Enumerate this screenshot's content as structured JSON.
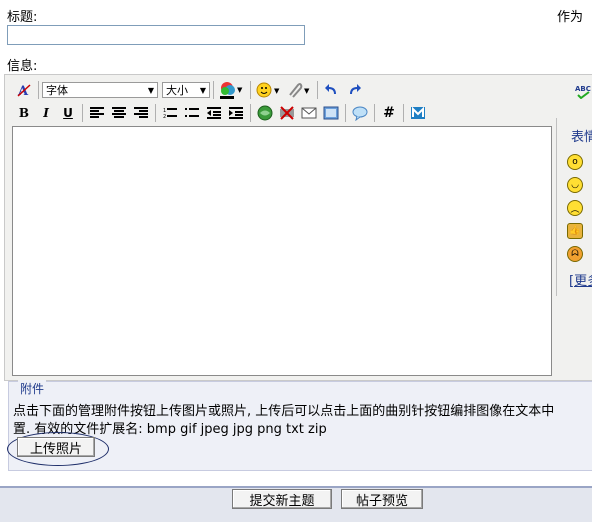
{
  "form": {
    "title_label": "标题:",
    "as_label": "作为",
    "message_label": "信息:"
  },
  "toolbar": {
    "font_select": "字体",
    "size_select": "大小",
    "bold": "B",
    "italic": "I",
    "underline": "U",
    "hash": "#"
  },
  "emoji_panel": {
    "title": "表情",
    "more": "[更多"
  },
  "attachments": {
    "legend": "附件",
    "help_line1": "点击下面的管理附件按钮上传图片或照片, 上传后可以点击上面的曲别针按钮编排图像在文本中",
    "help_line2": "置. 有效的文件扩展名: bmp gif jpeg jpg png txt zip",
    "upload_button": "上传照片"
  },
  "actions": {
    "submit": "提交新主题",
    "preview": "帖子预览"
  },
  "colors": {
    "legend_blue": "#1f3a8c",
    "attach_bg": "#eef0f7",
    "bottom_bar": "#e3e6ee"
  }
}
